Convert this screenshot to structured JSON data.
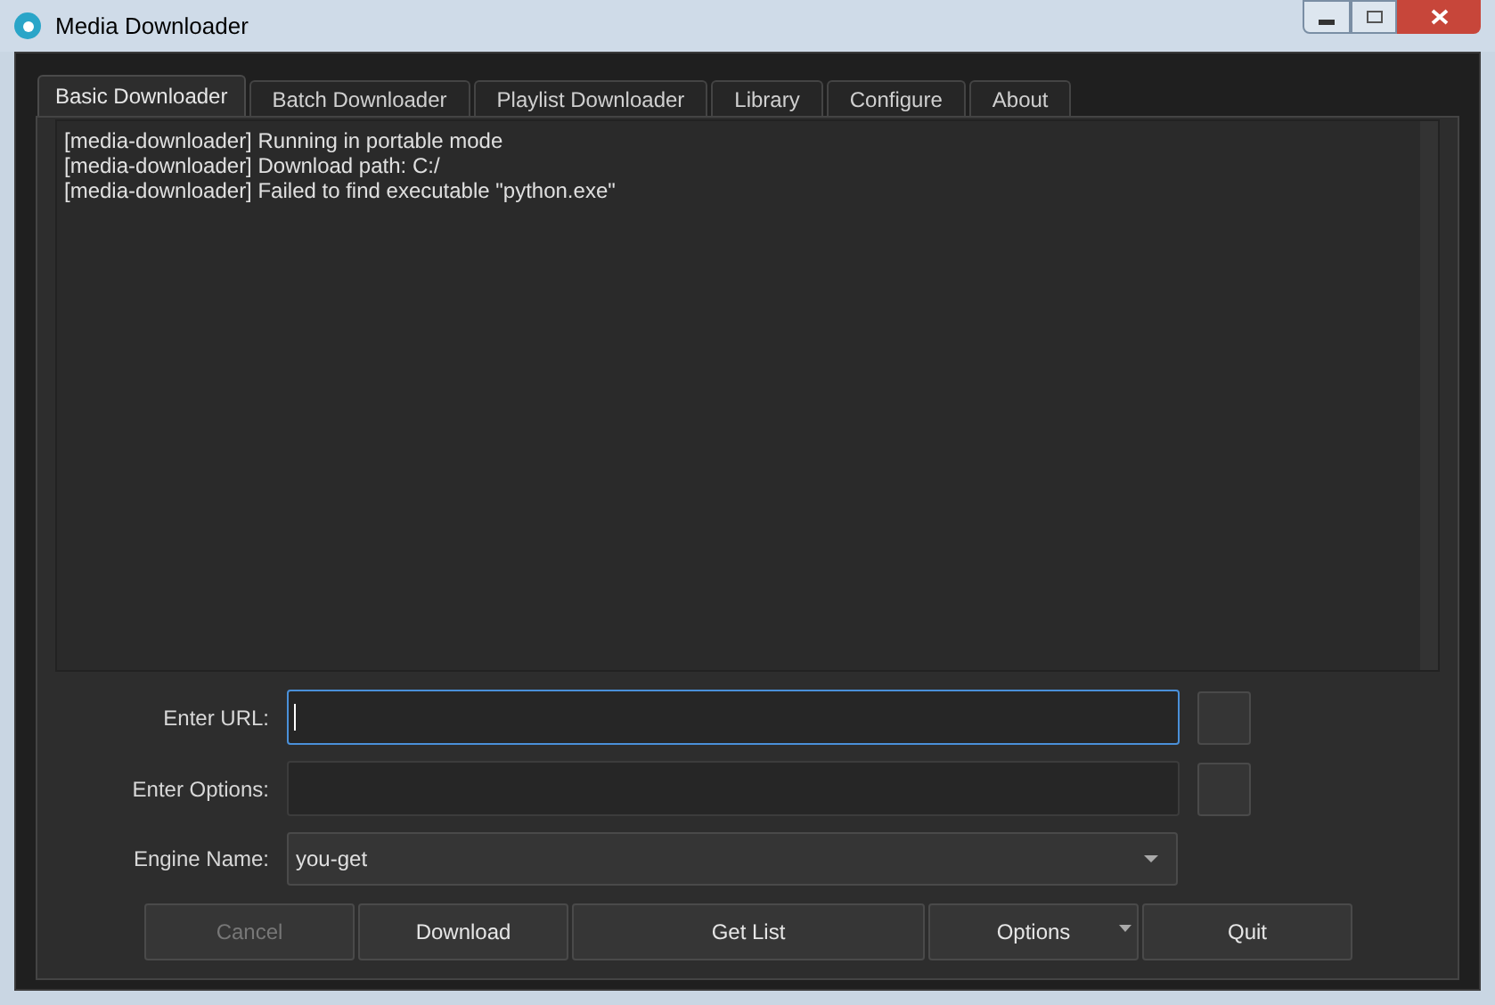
{
  "window": {
    "title": "Media Downloader"
  },
  "tabs": [
    {
      "label": "Basic Downloader",
      "selected": true
    },
    {
      "label": "Batch Downloader",
      "selected": false
    },
    {
      "label": "Playlist Downloader",
      "selected": false
    },
    {
      "label": "Library",
      "selected": false
    },
    {
      "label": "Configure",
      "selected": false
    },
    {
      "label": "About",
      "selected": false
    }
  ],
  "log": [
    "[media-downloader] Running in portable mode",
    "[media-downloader] Download path: C:/",
    "[media-downloader] Failed to find executable \"python.exe\""
  ],
  "form": [
    {
      "kind": "text",
      "label": "Enter URL:",
      "focused": true
    },
    {
      "kind": "text",
      "label": "Enter Options:",
      "focused": false
    },
    {
      "kind": "select",
      "label": "Engine Name:",
      "value": "you-get"
    }
  ],
  "buttons": [
    {
      "label": "Cancel",
      "disabled": true,
      "menu": false
    },
    {
      "label": "Download",
      "disabled": false,
      "menu": false
    },
    {
      "label": "Get List",
      "disabled": false,
      "menu": false
    },
    {
      "label": "Options",
      "disabled": false,
      "menu": true
    },
    {
      "label": "Quit",
      "disabled": false,
      "menu": false
    }
  ]
}
